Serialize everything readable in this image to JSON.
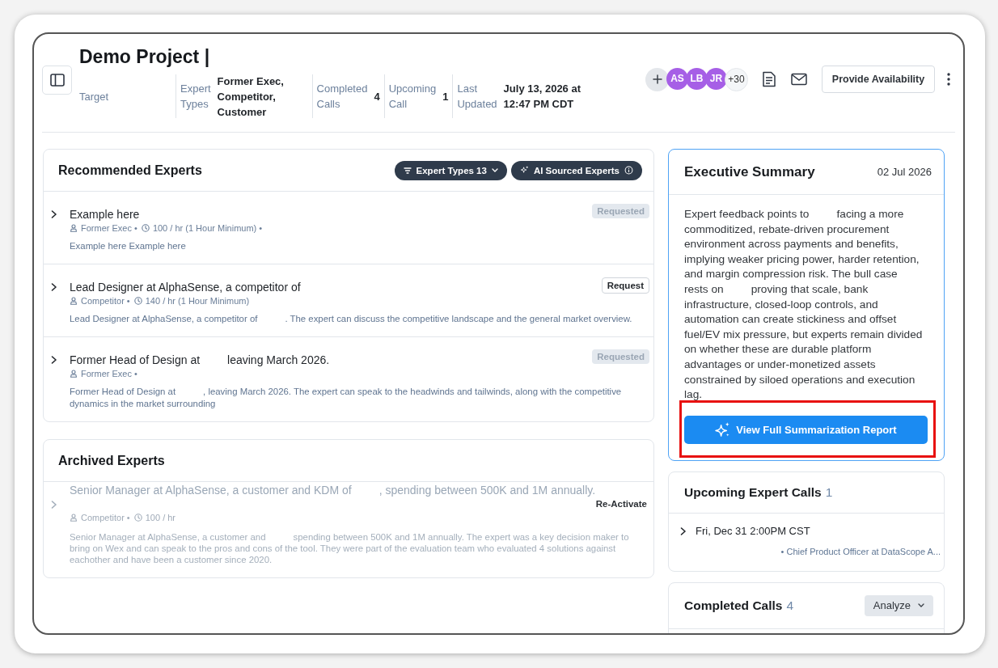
{
  "project": {
    "title": "Demo Project |",
    "fields": [
      {
        "label": "Target"
      },
      {
        "label": "Expert Types",
        "value": "Former Exec, Competitor, Customer"
      },
      {
        "label": "Completed Calls",
        "value": "4"
      },
      {
        "label": "Upcoming Call",
        "value": "1"
      },
      {
        "label": "Last Updated",
        "value": "July 13, 2026 at 12:47 PM CDT"
      }
    ]
  },
  "team": {
    "avatars": [
      {
        "initials": "AS"
      },
      {
        "initials": "LB"
      },
      {
        "initials": "JR"
      }
    ],
    "more": "+30"
  },
  "actions": {
    "availability_button": "Provide Availability"
  },
  "recommended": {
    "title": "Recommended Experts",
    "filters": [
      {
        "kind": "filter",
        "label": "Expert Types 13"
      },
      {
        "kind": "ai",
        "label": "AI Sourced Experts"
      }
    ],
    "experts": [
      {
        "title_parts": [
          "Example here"
        ],
        "meta": [
          {
            "kind": "type",
            "text": "Former Exec •"
          },
          {
            "kind": "rate",
            "text": "100 / hr (1 Hour Minimum) •"
          }
        ],
        "description_parts": [
          "Example here Example here"
        ],
        "action": {
          "kind": "status",
          "label": "Requested"
        },
        "expanded": false,
        "inactive": false
      },
      {
        "title_parts": [
          "Lead Designer at AlphaSense, a competitor of"
        ],
        "meta": [
          {
            "kind": "type",
            "text": "Competitor •"
          },
          {
            "kind": "rate",
            "text": "140 / hr (1 Hour Minimum)"
          }
        ],
        "description_parts": [
          "Lead Designer at AlphaSense, a competitor of",
          ". The expert can discuss the competitive landscape and the general market overview."
        ],
        "action": {
          "kind": "outline",
          "label": "Request"
        },
        "expanded": false,
        "inactive": false
      },
      {
        "title_parts": [
          "Former Head of Design at",
          "leaving March 2026."
        ],
        "meta": [
          {
            "kind": "type",
            "text": "Former Exec •"
          }
        ],
        "description_parts": [
          "Former Head of Design at",
          ", leaving March 2026. The expert can speak to the headwinds and tailwinds, along with the competitive dynamics in the market surrounding"
        ],
        "action": {
          "kind": "status",
          "label": "Requested"
        },
        "expanded": false,
        "inactive": false
      }
    ]
  },
  "archived": {
    "title": "Archived Experts",
    "experts": [
      {
        "title_parts": [
          "Senior Manager at AlphaSense, a customer and KDM of",
          ", spending between 500K and 1M annually."
        ],
        "meta": [
          {
            "kind": "type",
            "text": "Competitor •"
          },
          {
            "kind": "rate",
            "text": "100 / hr"
          }
        ],
        "description_parts": [
          "Senior Manager at AlphaSense, a customer and",
          "spending between 500K and 1M annually. The expert was a key decision maker to bring on Wex and can speak to the pros and cons of the tool. They were part of the evaluation team who evaluated 4 solutions against eachother and have been a customer since 2020."
        ],
        "action": {
          "kind": "text",
          "label": "Re-Activate"
        },
        "expanded": false,
        "inactive": true
      }
    ]
  },
  "summary": {
    "title": "Executive Summary",
    "date": "02 Jul 2026",
    "text_parts": [
      "Expert feedback points to",
      "facing a more commoditized, rebate-driven procurement environment across payments and benefits, implying weaker pricing power, harder retention, and margin compression risk. The bull case rests on",
      "proving that scale, bank infrastructure, closed-loop controls, and automation can create stickiness and offset fuel/EV mix pressure, but experts remain divided on whether these are durable platform advantages or under-monetized assets constrained by siloed operations and execution lag."
    ],
    "button": {
      "label": "View Full Summarization Report",
      "highlighted": true
    }
  },
  "upcoming_calls": {
    "title": "Upcoming Expert Calls",
    "count": "1",
    "calls": [
      {
        "time": "Fri, Dec 31 2:00PM CST",
        "expert": "• Chief Product Officer at DataScope A...",
        "expanded": false
      }
    ]
  },
  "completed_calls": {
    "title": "Completed Calls",
    "count": "4",
    "analyze_button": "Analyze"
  }
}
